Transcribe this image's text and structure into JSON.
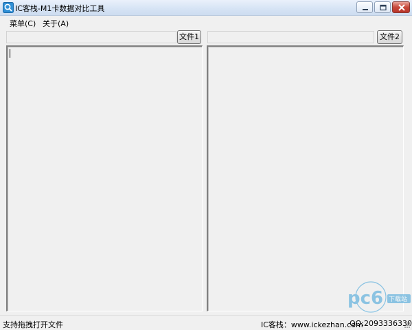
{
  "window": {
    "title": "IC客栈-M1卡数据对比工具",
    "icon": "search-app-icon",
    "controls": [
      "minimize-icon",
      "maximize-icon",
      "close-icon"
    ]
  },
  "menu": {
    "items": [
      {
        "label": "菜单(C)"
      },
      {
        "label": "关于(A)"
      }
    ]
  },
  "left": {
    "path_value": "",
    "button_label": "文件1"
  },
  "right": {
    "path_value": "",
    "button_label": "文件2"
  },
  "status": {
    "left_text": "支持拖拽打开文件",
    "site_text": "IC客栈：www.ickezhan.com",
    "qq_text": "QQ:2093336330"
  },
  "watermark": {
    "brand": "pc6",
    "text": "下载站"
  },
  "colors": {
    "window_bg": "#f0f0f0",
    "title_bar": "#dbe6f4",
    "close_button": "#c8493b",
    "watermark": "#3aa0d8"
  }
}
